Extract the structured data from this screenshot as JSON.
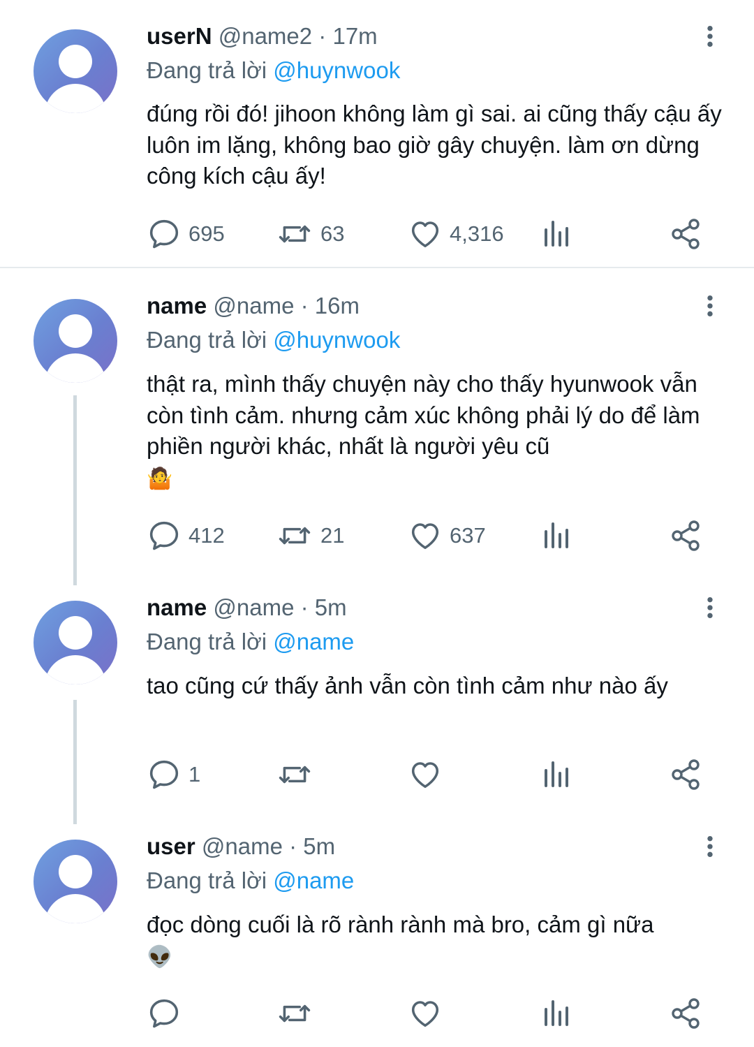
{
  "tweets": [
    {
      "username": "userN",
      "handle": "@name2",
      "separator": "·",
      "time": "17m",
      "reply_prefix": "Đang trả lời",
      "reply_to": "@huynwook",
      "text": "đúng rồi đó! jihoon không làm gì sai. ai cũng thấy cậu ấy luôn im lặng, không bao giờ gây chuyện. làm ơn dừng công kích cậu ấy!",
      "emoji": "",
      "replies": "695",
      "retweets": "63",
      "likes": "4,316"
    },
    {
      "username": "name",
      "handle": "@name",
      "separator": "·",
      "time": "16m",
      "reply_prefix": "Đang trả lời",
      "reply_to": "@huynwook",
      "text": "thật ra, mình thấy chuyện này cho thấy hyunwook vẫn còn tình cảm. nhưng cảm xúc không phải lý do để làm phiền người khác, nhất là người yêu cũ",
      "emoji": "🤷",
      "replies": "412",
      "retweets": "21",
      "likes": "637"
    },
    {
      "username": "name",
      "handle": "@name",
      "separator": "·",
      "time": "5m",
      "reply_prefix": "Đang trả lời",
      "reply_to": "@name",
      "text": "tao cũng cứ thấy ảnh vẫn còn tình cảm như nào ấy",
      "emoji": "",
      "replies": "1",
      "retweets": "",
      "likes": ""
    },
    {
      "username": "user",
      "handle": "@name",
      "separator": "·",
      "time": "5m",
      "reply_prefix": "Đang trả lời",
      "reply_to": "@name",
      "text": "đọc dòng cuối là rõ rành rành mà bro, cảm gì nữa",
      "emoji": "👽",
      "replies": "",
      "retweets": "",
      "likes": ""
    }
  ],
  "icons": {
    "reply": "reply-icon",
    "retweet": "retweet-icon",
    "like": "like-icon",
    "views": "views-icon",
    "share": "share-icon",
    "more": "more-options-icon"
  },
  "colors": {
    "text": "#0f1419",
    "secondary": "#536471",
    "mention": "#1d9bf0",
    "thread_line": "#cfd9de",
    "divider": "#e6eaed"
  }
}
